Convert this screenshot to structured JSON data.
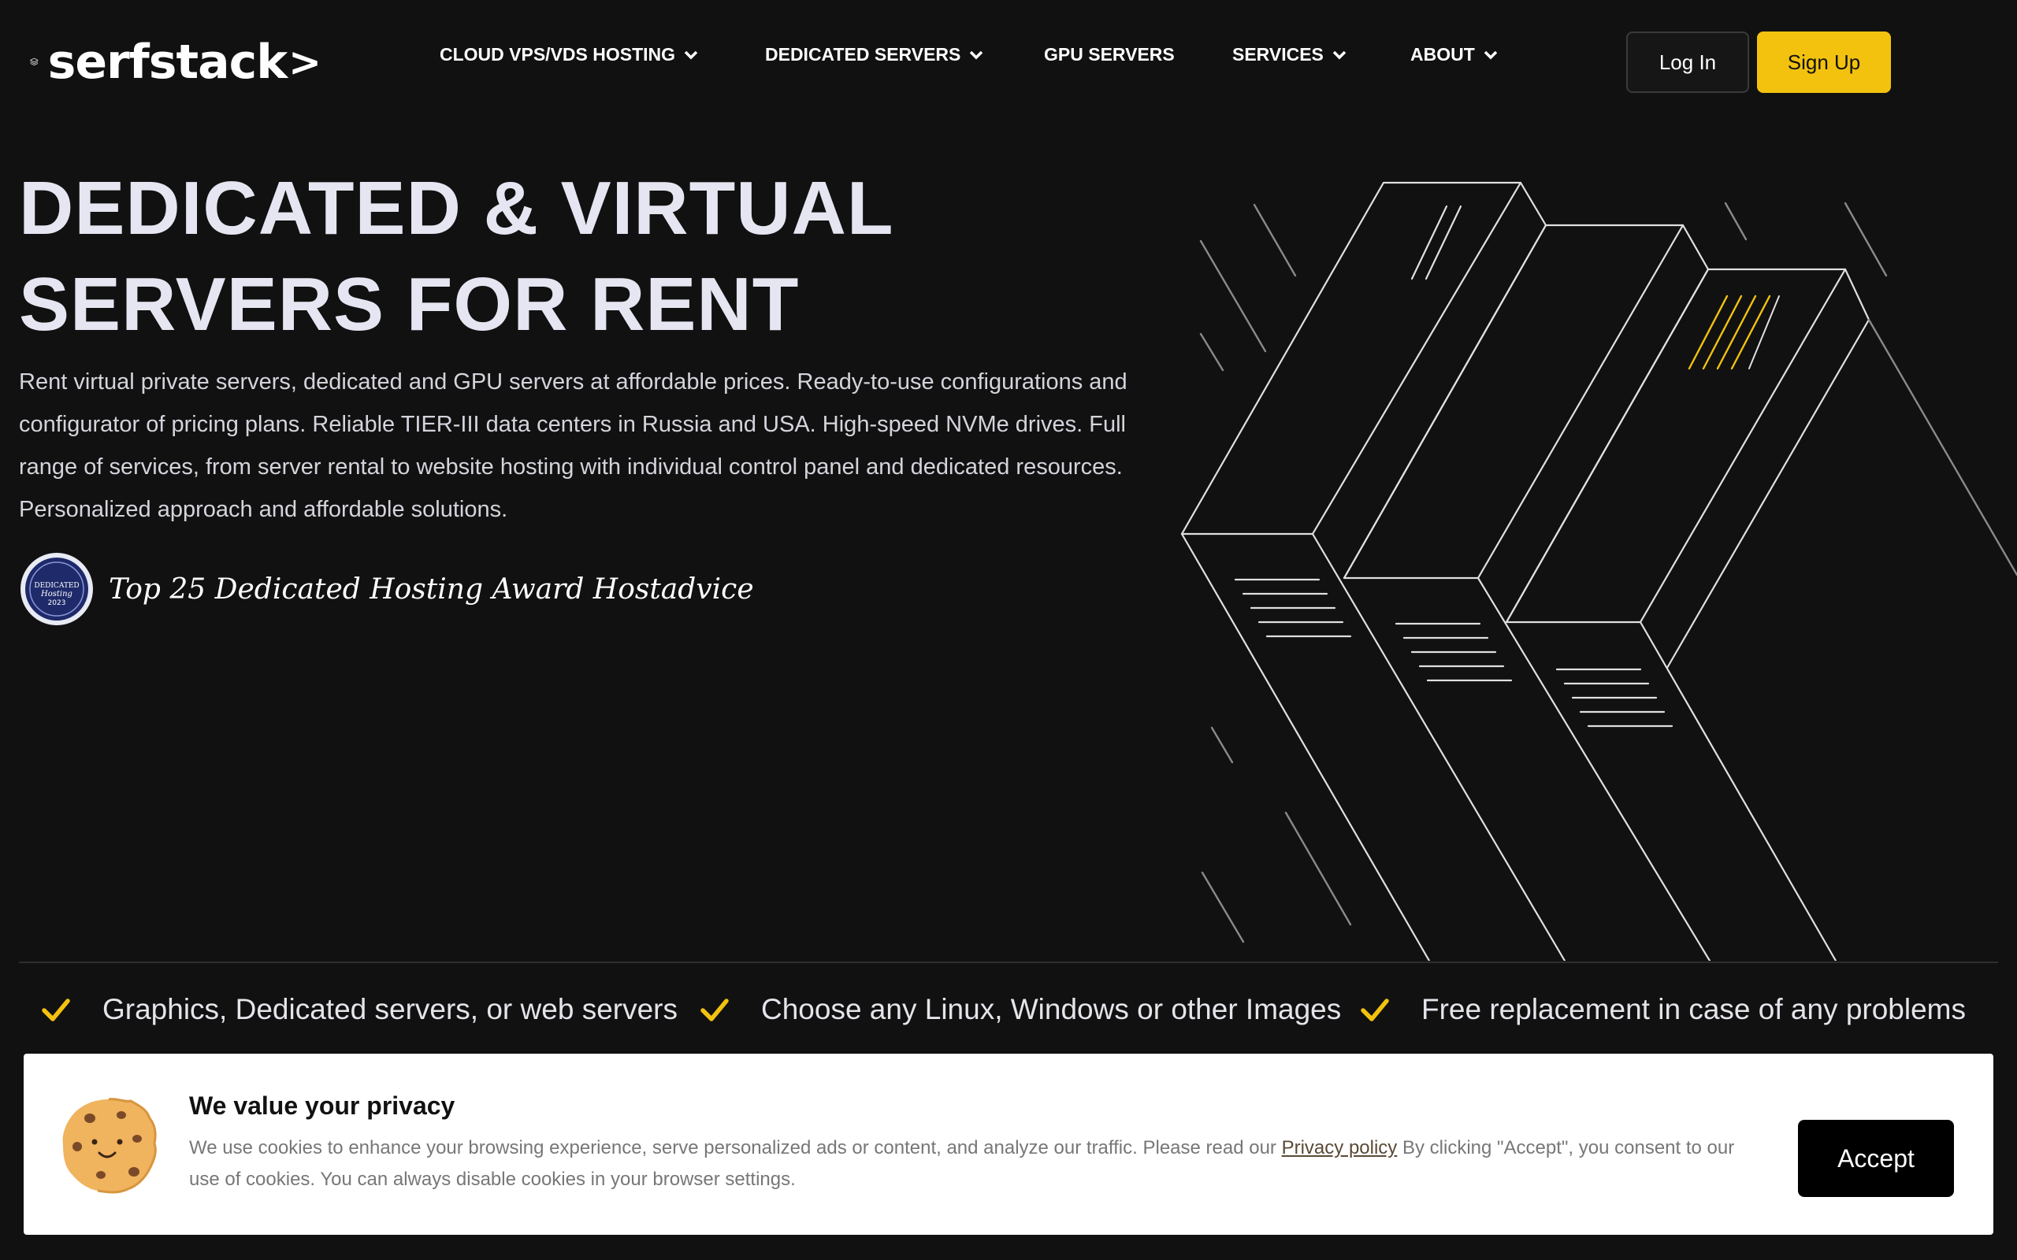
{
  "brand": {
    "logo_text": "serfstack",
    "logo_arrow": ">",
    "logo_icon": "stacked-layers-icon"
  },
  "nav": {
    "items": [
      {
        "label": "CLOUD VPS/VDS HOSTING",
        "has_dropdown": true
      },
      {
        "label": "DEDICATED SERVERS",
        "has_dropdown": true
      },
      {
        "label": "GPU SERVERS",
        "has_dropdown": false
      },
      {
        "label": "SERVICES",
        "has_dropdown": true
      },
      {
        "label": "ABOUT",
        "has_dropdown": true
      }
    ],
    "login_label": "Log In",
    "signup_label": "Sign Up"
  },
  "hero": {
    "title": "DEDICATED & VIRTUAL SERVERS FOR RENT",
    "description": "Rent virtual private servers, dedicated and GPU servers at affordable prices. Ready-to-use configurations and configurator of pricing plans. Reliable TIER-III data centers in Russia and USA. High-speed NVMe drives. Full range of services, from server rental to website hosting with individual control panel and dedicated resources. Personalized approach and affordable solutions.",
    "award_text": "Top 25 Dedicated Hosting Award Hostadvice",
    "award_badge": {
      "line1": "DEDICATED",
      "line2": "Hosting",
      "line3": "2023"
    }
  },
  "features": [
    {
      "icon": "check-icon",
      "text": "Graphics, Dedicated servers, or web servers"
    },
    {
      "icon": "check-icon",
      "text": "Choose any Linux, Windows or other Images"
    },
    {
      "icon": "check-icon",
      "text": "Free replacement in case of any problems"
    }
  ],
  "cookie": {
    "title": "We value your privacy",
    "text_before": "We use cookies to enhance your browsing experience, serve personalized ads or content, and analyze our traffic. Please read our ",
    "link_text": "Privacy policy",
    "text_after": " By clicking \"Accept\", you consent to our use of cookies. You can always disable cookies in your browser settings.",
    "accept_label": "Accept"
  },
  "colors": {
    "background": "#111111",
    "accent": "#f2c20f",
    "text": "#e6e6f2",
    "banner": "#ffffff"
  }
}
